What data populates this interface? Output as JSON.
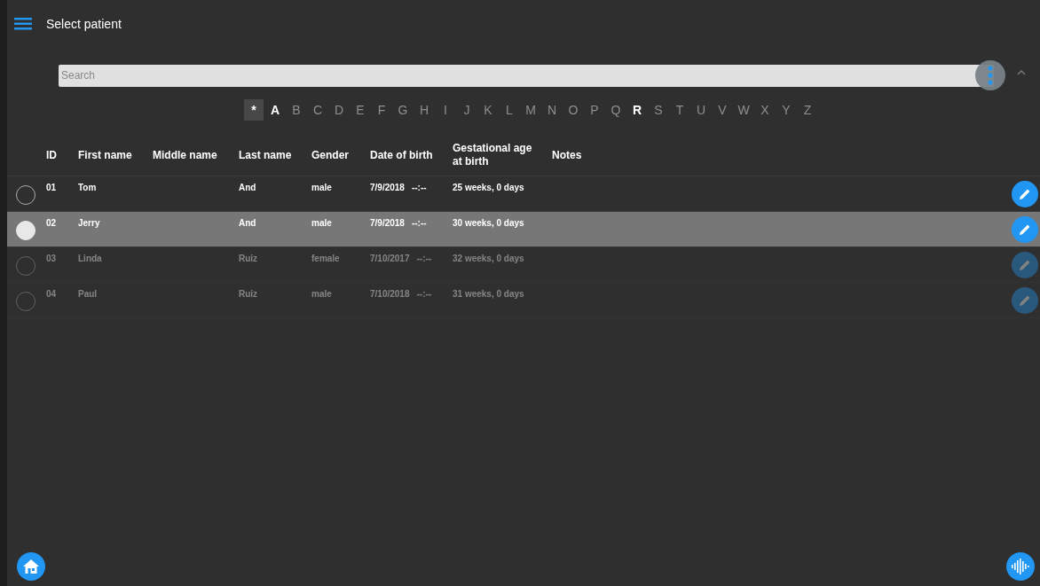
{
  "app_bar": {
    "title": "Select patient"
  },
  "search": {
    "placeholder": "Search"
  },
  "letters": [
    {
      "label": "*",
      "selected": true,
      "available": true
    },
    {
      "label": "A",
      "selected": false,
      "available": true
    },
    {
      "label": "B",
      "selected": false,
      "available": false
    },
    {
      "label": "C",
      "selected": false,
      "available": false
    },
    {
      "label": "D",
      "selected": false,
      "available": false
    },
    {
      "label": "E",
      "selected": false,
      "available": false
    },
    {
      "label": "F",
      "selected": false,
      "available": false
    },
    {
      "label": "G",
      "selected": false,
      "available": false
    },
    {
      "label": "H",
      "selected": false,
      "available": false
    },
    {
      "label": "I",
      "selected": false,
      "available": false
    },
    {
      "label": "J",
      "selected": false,
      "available": false
    },
    {
      "label": "K",
      "selected": false,
      "available": false
    },
    {
      "label": "L",
      "selected": false,
      "available": false
    },
    {
      "label": "M",
      "selected": false,
      "available": false
    },
    {
      "label": "N",
      "selected": false,
      "available": false
    },
    {
      "label": "O",
      "selected": false,
      "available": false
    },
    {
      "label": "P",
      "selected": false,
      "available": false
    },
    {
      "label": "Q",
      "selected": false,
      "available": false
    },
    {
      "label": "R",
      "selected": false,
      "available": true
    },
    {
      "label": "S",
      "selected": false,
      "available": false
    },
    {
      "label": "T",
      "selected": false,
      "available": false
    },
    {
      "label": "U",
      "selected": false,
      "available": false
    },
    {
      "label": "V",
      "selected": false,
      "available": false
    },
    {
      "label": "W",
      "selected": false,
      "available": false
    },
    {
      "label": "X",
      "selected": false,
      "available": false
    },
    {
      "label": "Y",
      "selected": false,
      "available": false
    },
    {
      "label": "Z",
      "selected": false,
      "available": false
    }
  ],
  "table": {
    "columns": [
      "ID",
      "First name",
      "Middle name",
      "Last name",
      "Gender",
      "Date of birth",
      "Gestational age at birth",
      "Notes"
    ],
    "rows": [
      {
        "selected": false,
        "disabled": false,
        "id": "01",
        "first_name": "Tom",
        "last_name": "And",
        "gender": "male",
        "date_of_birth": "7/9/2018",
        "time_of_birth": "--:--",
        "gestational_age": "25 weeks, 0 days"
      },
      {
        "selected": true,
        "disabled": false,
        "id": "02",
        "first_name": "Jerry",
        "last_name": "And",
        "gender": "male",
        "date_of_birth": "7/9/2018",
        "time_of_birth": "--:--",
        "gestational_age": "30 weeks, 0 days"
      },
      {
        "selected": false,
        "disabled": true,
        "id": "03",
        "first_name": "Linda",
        "last_name": "Ruiz",
        "gender": "female",
        "date_of_birth": "7/10/2017",
        "time_of_birth": "--:--",
        "gestational_age": "32 weeks, 0 days"
      },
      {
        "selected": false,
        "disabled": true,
        "id": "04",
        "first_name": "Paul",
        "last_name": "Ruiz",
        "gender": "male",
        "date_of_birth": "7/10/2018",
        "time_of_birth": "--:--",
        "gestational_age": "31 weeks, 0 days"
      }
    ]
  }
}
